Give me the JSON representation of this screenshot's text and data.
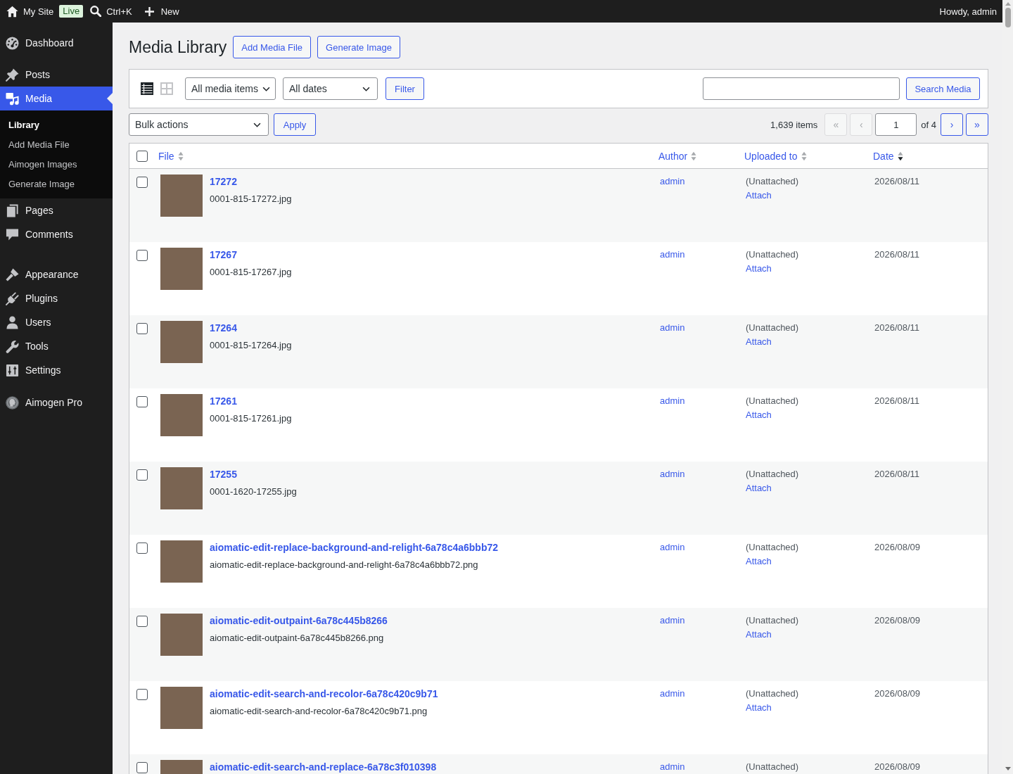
{
  "admin_bar": {
    "site": "My Site",
    "badge": "Live",
    "search": "Ctrl+K",
    "new": "New",
    "greeting": "Howdy, admin"
  },
  "sidebar": {
    "groups": [
      {
        "items": [
          {
            "label": "Dashboard",
            "selected": false
          }
        ]
      },
      {
        "items": [
          {
            "label": "Posts",
            "selected": false
          },
          {
            "label": "Media",
            "selected": true,
            "children": [
              {
                "label": "Library",
                "selected": true
              },
              {
                "label": "Add Media File",
                "selected": false
              },
              {
                "label": "Aimogen Images",
                "selected": false
              },
              {
                "label": "Generate Image",
                "selected": false
              }
            ]
          },
          {
            "label": "Pages",
            "selected": false
          },
          {
            "label": "Comments",
            "selected": false
          }
        ]
      },
      {
        "items": [
          {
            "label": "Appearance",
            "selected": false
          },
          {
            "label": "Plugins",
            "selected": false
          },
          {
            "label": "Users",
            "selected": false
          },
          {
            "label": "Tools",
            "selected": false
          },
          {
            "label": "Settings",
            "selected": false
          }
        ]
      },
      {
        "items": [
          {
            "label": "Aimogen Pro",
            "selected": false
          }
        ]
      }
    ]
  },
  "page": {
    "title": "Media Library",
    "actions": [
      "Add Media File",
      "Generate Image"
    ]
  },
  "filters": {
    "views": [
      {
        "kind": "list",
        "selected": true
      },
      {
        "kind": "grid",
        "selected": false
      }
    ],
    "type_select": "All media items",
    "date_select": "All dates",
    "filter_button": "Filter",
    "search_button": "Search Media"
  },
  "toolbar": {
    "bulk_select": "Bulk actions",
    "apply_button": "Apply",
    "item_count": "1,639 items",
    "pagination": {
      "buttons": [
        {
          "label": "«",
          "disabled": true
        },
        {
          "label": "‹",
          "disabled": true
        },
        {
          "label": "›",
          "disabled": false
        },
        {
          "label": "»",
          "disabled": false
        }
      ],
      "current_page": "1",
      "page_total": "of 4"
    }
  },
  "table": {
    "select_all": {
      "checked": false
    },
    "columns": [
      {
        "label": "File",
        "sorted": false
      },
      {
        "label": "Author",
        "sorted": false
      },
      {
        "label": "Uploaded to",
        "sorted": false
      },
      {
        "label": "Date",
        "sorted": true
      }
    ],
    "rows": [
      {
        "title": "17272",
        "filename": "0001-815-17272.jpg",
        "author": "admin",
        "uploaded_to": "(Unattached)",
        "action": "Attach",
        "date": "2026/08/11",
        "checked": false
      },
      {
        "title": "17267",
        "filename": "0001-815-17267.jpg",
        "author": "admin",
        "uploaded_to": "(Unattached)",
        "action": "Attach",
        "date": "2026/08/11",
        "checked": false
      },
      {
        "title": "17264",
        "filename": "0001-815-17264.jpg",
        "author": "admin",
        "uploaded_to": "(Unattached)",
        "action": "Attach",
        "date": "2026/08/11",
        "checked": false
      },
      {
        "title": "17261",
        "filename": "0001-815-17261.jpg",
        "author": "admin",
        "uploaded_to": "(Unattached)",
        "action": "Attach",
        "date": "2026/08/11",
        "checked": false
      },
      {
        "title": "17255",
        "filename": "0001-1620-17255.jpg",
        "author": "admin",
        "uploaded_to": "(Unattached)",
        "action": "Attach",
        "date": "2026/08/11",
        "checked": false
      },
      {
        "title": "aiomatic-edit-replace-background-and-relight-6a78c4a6bbb72",
        "filename": "aiomatic-edit-replace-background-and-relight-6a78c4a6bbb72.png",
        "author": "admin",
        "uploaded_to": "(Unattached)",
        "action": "Attach",
        "date": "2026/08/09",
        "checked": false
      },
      {
        "title": "aiomatic-edit-outpaint-6a78c445b8266",
        "filename": "aiomatic-edit-outpaint-6a78c445b8266.png",
        "author": "admin",
        "uploaded_to": "(Unattached)",
        "action": "Attach",
        "date": "2026/08/09",
        "checked": false
      },
      {
        "title": "aiomatic-edit-search-and-recolor-6a78c420c9b71",
        "filename": "aiomatic-edit-search-and-recolor-6a78c420c9b71.png",
        "author": "admin",
        "uploaded_to": "(Unattached)",
        "action": "Attach",
        "date": "2026/08/09",
        "checked": false
      },
      {
        "title": "aiomatic-edit-search-and-replace-6a78c3f010398",
        "author": "admin",
        "uploaded_to": "(Unattached)",
        "date": "2026/08/09",
        "checked": false
      }
    ]
  }
}
